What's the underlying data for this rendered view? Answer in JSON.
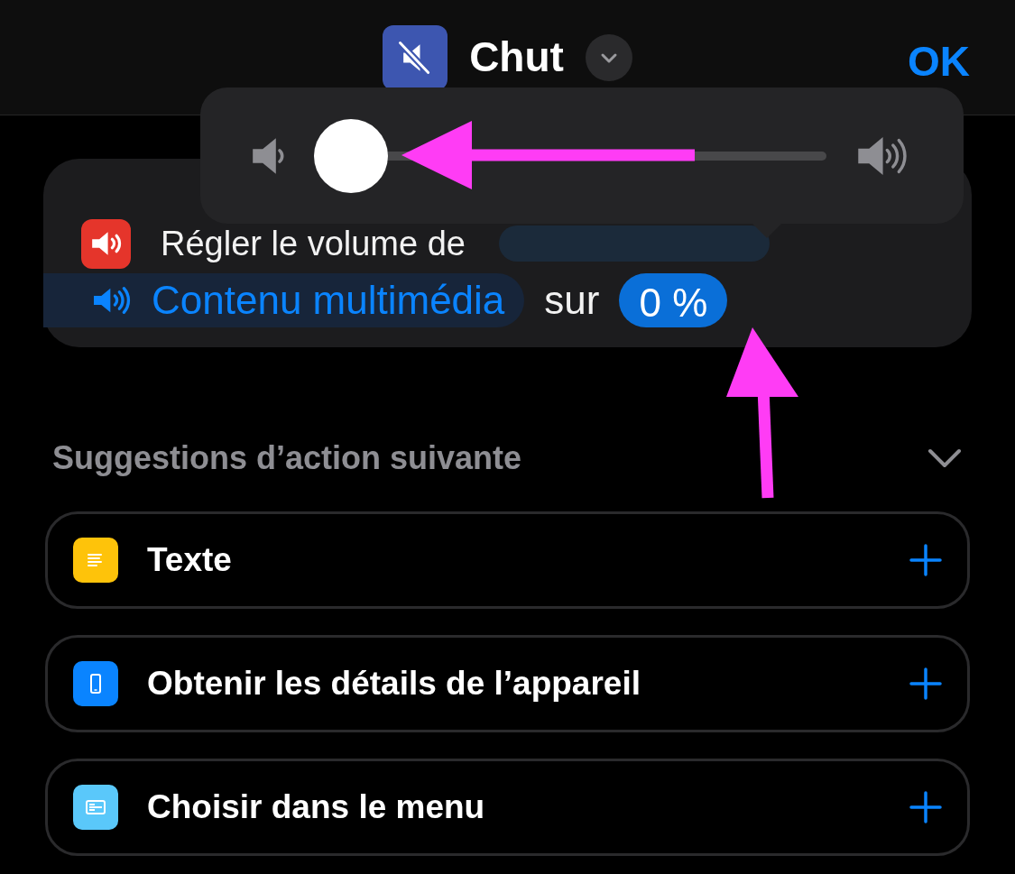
{
  "header": {
    "title": "Chut",
    "button": "OK"
  },
  "volume_popover": {
    "level": 0
  },
  "action": {
    "line_1": "Régler le volume de",
    "parameter": "Contenu multimédia",
    "connector": "sur",
    "value": "0 %"
  },
  "suggestions": {
    "title": "Suggestions d’action suivante",
    "expanded": true,
    "items": [
      {
        "label": "Texte",
        "kind": "text",
        "color": "#fec30a"
      },
      {
        "label": "Obtenir les détails de l’appareil",
        "kind": "device",
        "color": "#0a84ff"
      },
      {
        "label": "Choisir dans le menu",
        "kind": "menu",
        "color": "#5ac8fa"
      }
    ]
  }
}
